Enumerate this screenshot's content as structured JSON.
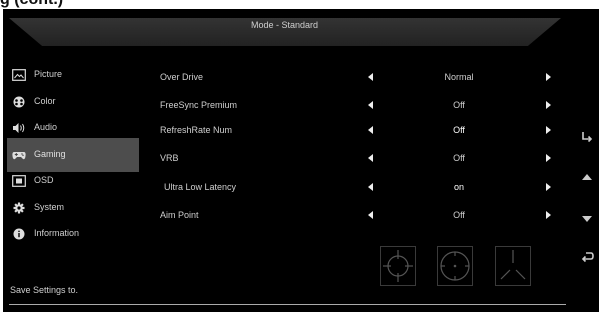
{
  "heading": "g (cont.)",
  "title": "Mode - Standard",
  "sidebar": {
    "items": [
      {
        "label": "Picture",
        "icon": "picture-icon"
      },
      {
        "label": "Color",
        "icon": "color-palette-icon"
      },
      {
        "label": "Audio",
        "icon": "speaker-icon"
      },
      {
        "label": "Gaming",
        "icon": "gamepad-icon",
        "selected": true
      },
      {
        "label": "OSD",
        "icon": "osd-icon"
      },
      {
        "label": "System",
        "icon": "gear-icon"
      },
      {
        "label": "Information",
        "icon": "info-icon"
      }
    ],
    "save_settings": "Save Settings to."
  },
  "settings": [
    {
      "label": "Over Drive",
      "value": "Normal"
    },
    {
      "label": "FreeSync Premium",
      "value": "Off"
    },
    {
      "label": "RefreshRate Num",
      "value": "Off"
    },
    {
      "label": "VRB",
      "value": "Off"
    },
    {
      "label": "Ultra Low Latency",
      "value": "on"
    },
    {
      "label": "Aim Point",
      "value": "Off"
    }
  ],
  "aim_point_options": [
    "crosshair-circle-icon",
    "crosshair-dot-circle-icon",
    "crosshair-corner-icon"
  ],
  "side_buttons": [
    "enter-icon",
    "up-arrow-icon",
    "down-arrow-icon",
    "back-icon"
  ]
}
